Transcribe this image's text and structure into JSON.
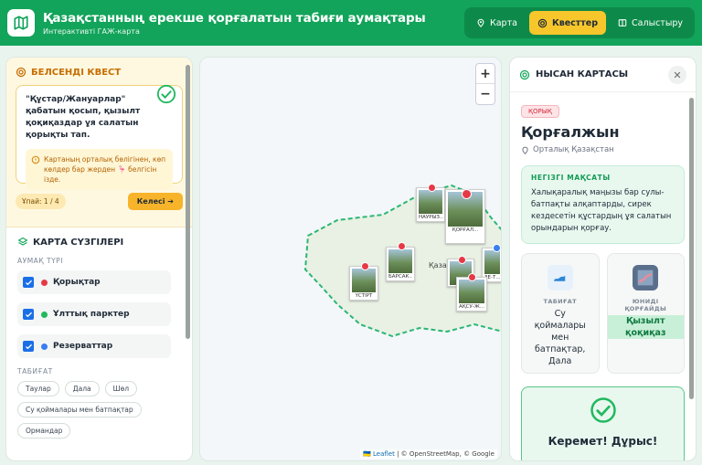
{
  "header": {
    "title": "Қазақстанның ерекше қорғалатын табиғи аумақтары",
    "subtitle": "Интерактивті ГАЖ-карта",
    "nav": [
      {
        "label": "Карта",
        "icon": "location-pin-icon",
        "active": false
      },
      {
        "label": "Квесттер",
        "icon": "target-icon",
        "active": true
      },
      {
        "label": "Салыстыру",
        "icon": "book-icon",
        "active": false
      }
    ]
  },
  "quest": {
    "heading": "БЕЛСЕНДІ КВЕСТ",
    "task": "\"Құстар/Жануарлар\" қабатын қосып, қызылт қоқиқаздар ұя салатын қорықты тап.",
    "hint": "Картаның орталық бөлігінен, көп көлдер бар жерден 🦩 белгісін ізде.",
    "progress": "Ұпай: 1 / 4",
    "next": "Келесі ➔"
  },
  "filters": {
    "heading": "КАРТА СҮЗГІЛЕРІ",
    "area_label": "АУМАҚ ТҮРІ",
    "types": [
      {
        "label": "Қорықтар",
        "color": "#e63946"
      },
      {
        "label": "Ұлттық парктер",
        "color": "#22b85f"
      },
      {
        "label": "Резерваттар",
        "color": "#3a7df0"
      }
    ],
    "nature_label": "ТАБИҒАТ",
    "nature": [
      "Таулар",
      "Дала",
      "Шөл",
      "Су қоймалары мен батпақтар",
      "Ормандар"
    ]
  },
  "map": {
    "zoom_in": "+",
    "zoom_out": "−",
    "country_label": "Қазақстан",
    "markers": [
      "НАУРЫЗ...",
      "ҚОРҒАЛ...",
      "ҮСТІРТ",
      "БАРСАК...",
      "АҚСУ-Ж...",
      "ЗЕ-Т..."
    ],
    "attribution_leaflet": "🇺🇦 Leaflet",
    "attribution_rest": "| © OpenStreetMap, © Google"
  },
  "panel": {
    "heading": "НЫСАН КАРТАСЫ",
    "badge": "ҚОРЫҚ",
    "title": "Қорғалжын",
    "region": "Орталық Қазақстан",
    "goal_label": "НЕГІЗГІ МАҚСАТЫ",
    "goal_text": "Халықаралық маңызы бар сулы-батпақты алқаптарды, сирек кездесетін құстардың ұя салатын орындарын қорғау.",
    "nature_label": "ТАБИҒАТ",
    "nature_value": "Су қоймалары мен батпақтар, Дала",
    "symbol_label": "ЮНИДІ ҚОРҒАЙДЫ",
    "symbol_value": "Қызылт қоқиқаз",
    "success": "Керемет! Дұрыс!"
  },
  "colors": {
    "brand": "#12a45a",
    "accent": "#f7c62b"
  }
}
